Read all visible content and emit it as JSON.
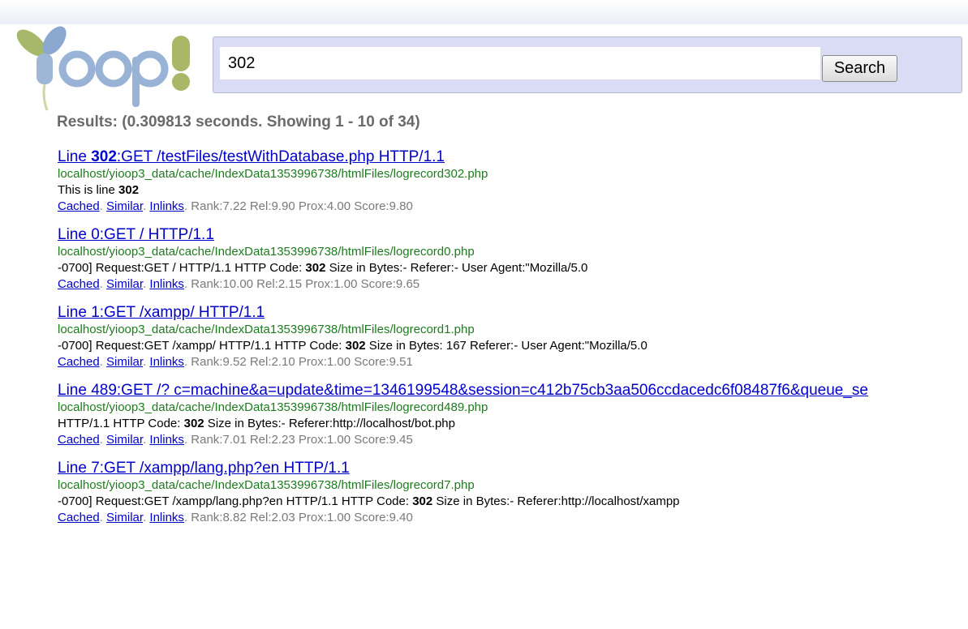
{
  "logo_text": "Yoop!",
  "search": {
    "value": "302",
    "button_label": "Search"
  },
  "results_summary": "Results: (0.309813 seconds. Showing 1 - 10 of 34)",
  "action_labels": {
    "cached": "Cached",
    "similar": "Similar",
    "inlinks": "Inlinks"
  },
  "results": [
    {
      "title_pre": "Line ",
      "title_bold": "302",
      "title_post": ":GET /testFiles/testWithDatabase.php HTTP/1.1",
      "url": "localhost/yioop3_data/cache/IndexData1353996738/htmlFiles/logrecord302.php",
      "snippet_pre": "This is line ",
      "snippet_bold": "302",
      "snippet_post": "",
      "meta": "Rank:7.22 Rel:9.90 Prox:4.00 Score:9.80"
    },
    {
      "title_pre": "Line 0:GET / HTTP/1.1",
      "title_bold": "",
      "title_post": "",
      "url": "localhost/yioop3_data/cache/IndexData1353996738/htmlFiles/logrecord0.php",
      "snippet_pre": "-0700] Request:GET / HTTP/1.1 HTTP Code: ",
      "snippet_bold": "302",
      "snippet_post": " Size in Bytes:- Referer:- User Agent:\"Mozilla/5.0",
      "meta": "Rank:10.00 Rel:2.15 Prox:1.00 Score:9.65"
    },
    {
      "title_pre": "Line 1:GET /xampp/ HTTP/1.1",
      "title_bold": "",
      "title_post": "",
      "url": "localhost/yioop3_data/cache/IndexData1353996738/htmlFiles/logrecord1.php",
      "snippet_pre": "-0700] Request:GET /xampp/ HTTP/1.1 HTTP Code: ",
      "snippet_bold": "302",
      "snippet_post": " Size in Bytes: 167 Referer:- User Agent:\"Mozilla/5.0",
      "meta": "Rank:9.52 Rel:2.10 Prox:1.00 Score:9.51"
    },
    {
      "title_pre": "Line 489:GET /? c=machine&a=update&time=1346199548&session=c412b75cb3aa506ccdacedc6f08487f6&queue_se",
      "title_bold": "",
      "title_post": "",
      "url": "localhost/yioop3_data/cache/IndexData1353996738/htmlFiles/logrecord489.php",
      "snippet_pre": "HTTP/1.1 HTTP Code: ",
      "snippet_bold": "302",
      "snippet_post": " Size in Bytes:- Referer:http://localhost/bot.php",
      "meta": "Rank:7.01 Rel:2.23 Prox:1.00 Score:9.45"
    },
    {
      "title_pre": "Line 7:GET /xampp/lang.php?en HTTP/1.1",
      "title_bold": "",
      "title_post": "",
      "url": "localhost/yioop3_data/cache/IndexData1353996738/htmlFiles/logrecord7.php",
      "snippet_pre": "-0700] Request:GET /xampp/lang.php?en HTTP/1.1 HTTP Code: ",
      "snippet_bold": "302",
      "snippet_post": " Size in Bytes:- Referer:http://localhost/xampp",
      "meta": "Rank:8.82 Rel:2.03 Prox:1.00 Score:9.40"
    }
  ]
}
